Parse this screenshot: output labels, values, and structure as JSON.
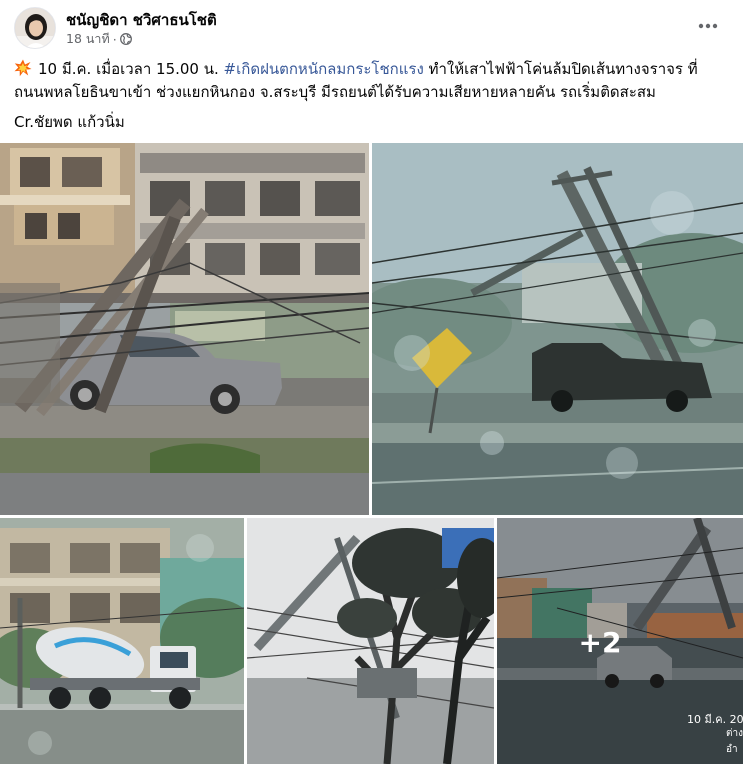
{
  "post": {
    "author": "ชนัญชิดา ชวิศาธนโชติ",
    "time": "18 นาที",
    "dot": "·",
    "more_icon": "more-horizontal-icon",
    "privacy_icon": "globe-icon",
    "emoji_icon": "collision-emoji-icon",
    "text_line1_pre": "10 มี.ค. เมื่อเวลา 15.00 น. ",
    "hashtag": "#เกิดฝนตกหนักลมกระโชกแรง",
    "text_line1_post": "  ทำให้เสาไฟฟ้าโค่นล้มปิดเส้นทางจราจร ที่",
    "text_line2": "ถนนพหลโยธินขาเข้า ช่วงแยกหินกอง จ.สระบุรี  มีรถยนต์ได้รับความเสียหายหลายคัน รถเริ่มติดสะสม",
    "credit": "Cr.ชัยพด แก้วนิ่ม",
    "hashtag_color": "#385898"
  },
  "photos": {
    "more_count": "+2",
    "timestamp": "10 มี.ค. 20",
    "stamp_line2": "ต่าง",
    "stamp_line3": "อำ"
  }
}
